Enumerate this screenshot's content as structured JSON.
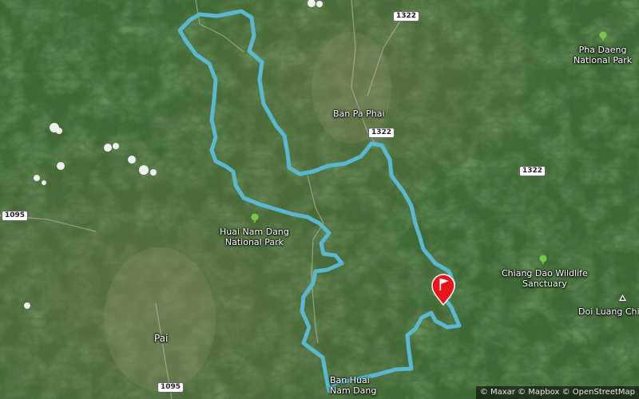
{
  "map": {
    "places": {
      "ban_pa_phai": "Ban Pa Phai",
      "pai": "Pai",
      "ban_huai_nam_dang": [
        "Ban Huai",
        "Nam Dang"
      ],
      "doi_luang_chiang_dao": "Doi Luang Chia"
    },
    "parks": {
      "huai_nam_dang": [
        "Huai Nam Dang",
        "National Park"
      ],
      "pha_daeng": [
        "Pha Daeng",
        "National Park"
      ],
      "chiang_dao": [
        "Chiang Dao Wildlife",
        "Sanctuary"
      ]
    },
    "road_shields": {
      "r1322_top": "1322",
      "r1322_mid": "1322",
      "r1322_east": "1322",
      "r1095_west": "1095",
      "r1095_south": "1095"
    },
    "attribution": "© Maxar © Mapbox © OpenStreetMap",
    "colors": {
      "route": "#5ab8d0",
      "marker": "#e8141c",
      "park_icon": "#7cc34a"
    },
    "icons": {
      "marker": "finish-flag-pin",
      "park": "tree-icon",
      "peak": "mountain-peak-icon"
    }
  }
}
